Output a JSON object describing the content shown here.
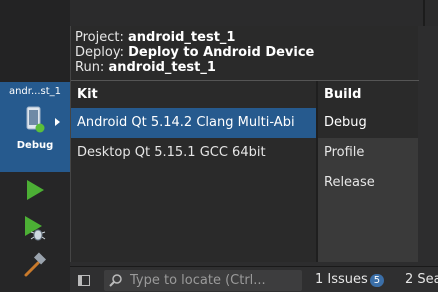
{
  "target_selector": {
    "name": "andr...st_1",
    "config": "Debug",
    "device_icon": "android-device-icon"
  },
  "sidebar_buttons": [
    {
      "name": "run",
      "icon": "play-icon"
    },
    {
      "name": "debug",
      "icon": "play-bug-icon"
    },
    {
      "name": "build",
      "icon": "hammer-icon"
    }
  ],
  "popup": {
    "project_label": "Project:",
    "project_value": "android_test_1",
    "deploy_label": "Deploy:",
    "deploy_value": "Deploy to Android Device",
    "run_label": "Run:",
    "run_value": "android_test_1",
    "kit_header": "Kit",
    "build_header": "Build",
    "kits": [
      {
        "label": "Android Qt 5.14.2 Clang Multi-Abi",
        "selected": true
      },
      {
        "label": "Desktop Qt 5.15.1 GCC 64bit",
        "selected": false
      }
    ],
    "builds": [
      {
        "label": "Debug",
        "selected": true
      },
      {
        "label": "Profile",
        "selected": false
      },
      {
        "label": "Release",
        "selected": false
      }
    ]
  },
  "status_bar": {
    "locator_placeholder": "Type to locate (Ctrl...",
    "issues_label": "1  Issues",
    "issues_count": "5",
    "search_label": "2  Sea"
  },
  "colors": {
    "accent": "#265a8e",
    "run_green": "#4caf35"
  }
}
